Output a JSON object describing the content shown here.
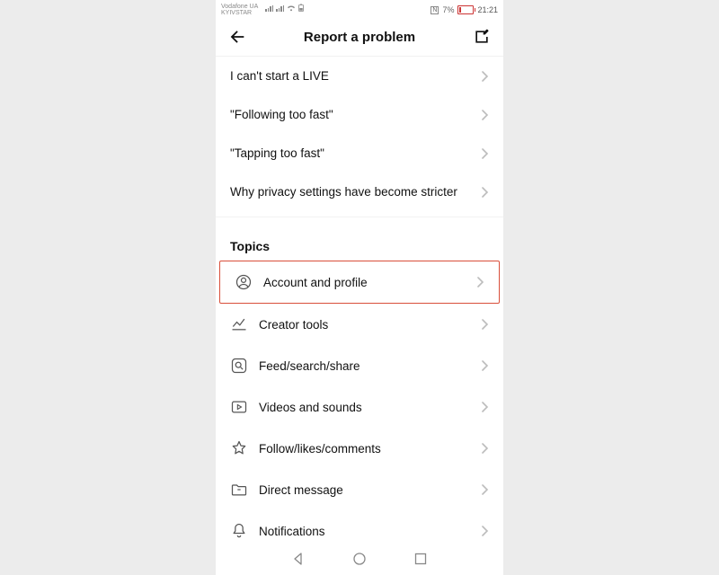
{
  "status_bar": {
    "carrier1": "Vodafone UA",
    "carrier2": "KYIVSTAR",
    "battery_pct": "7%",
    "clock": "21:21"
  },
  "header": {
    "title": "Report a problem"
  },
  "faq": [
    "I can't start a LIVE",
    "\"Following too fast\"",
    "\"Tapping too fast\"",
    "Why privacy settings have become stricter"
  ],
  "topics_header": "Topics",
  "topics": [
    "Account and profile",
    "Creator tools",
    "Feed/search/share",
    "Videos and sounds",
    "Follow/likes/comments",
    "Direct message",
    "Notifications"
  ],
  "highlight_index": 0
}
